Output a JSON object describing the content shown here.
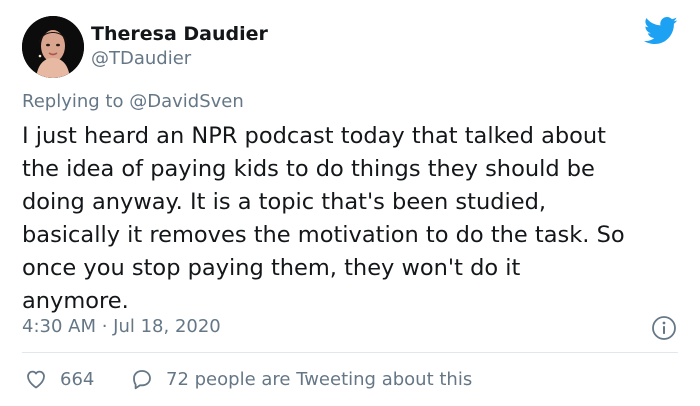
{
  "author": {
    "display_name": "Theresa Daudier",
    "handle": "@TDaudier"
  },
  "reply_to": {
    "prefix": "Replying to",
    "mention": "@DavidSven"
  },
  "tweet": {
    "lines": [
      "I just heard an NPR podcast today that talked about",
      "the idea of paying kids to do things they should be",
      "doing anyway. It is a topic that's been studied,",
      "basically it removes the motivation to do the task. So",
      "once you stop paying them, they won't do it",
      "anymore."
    ],
    "timestamp": "4:30 AM · Jul 18, 2020"
  },
  "actions": {
    "likes": "664",
    "replies_text": "72 people are Tweeting about this"
  },
  "icons": {
    "brand": "twitter-bird-icon",
    "info": "info-icon",
    "like": "heart-icon",
    "reply": "speech-bubble-icon"
  },
  "colors": {
    "brand_blue": "#1da1f2",
    "text": "#14171a",
    "secondary": "#657786",
    "divider": "#e1e8ed"
  }
}
